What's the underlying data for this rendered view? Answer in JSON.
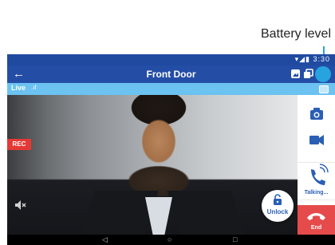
{
  "callout": {
    "label": "Battery level"
  },
  "status_bar": {
    "icons": "▾◢▮ 3:30"
  },
  "app_bar": {
    "back": "←",
    "title": "Front Door"
  },
  "live_bar": {
    "label": "Live",
    "signal": ".ıl"
  },
  "video": {
    "rec_label": "REC"
  },
  "controls": {
    "unlock_label": "Unlock",
    "talk_label": "Talking...",
    "end_label": "End"
  },
  "nav_bar": {
    "back": "◁",
    "home": "○",
    "recents": "□"
  },
  "colors": {
    "app_bar": "#244ea6",
    "live_bar": "#6cc2f0",
    "accent": "#27a3e0",
    "rec": "#e53935",
    "end": "#e64b4b"
  }
}
